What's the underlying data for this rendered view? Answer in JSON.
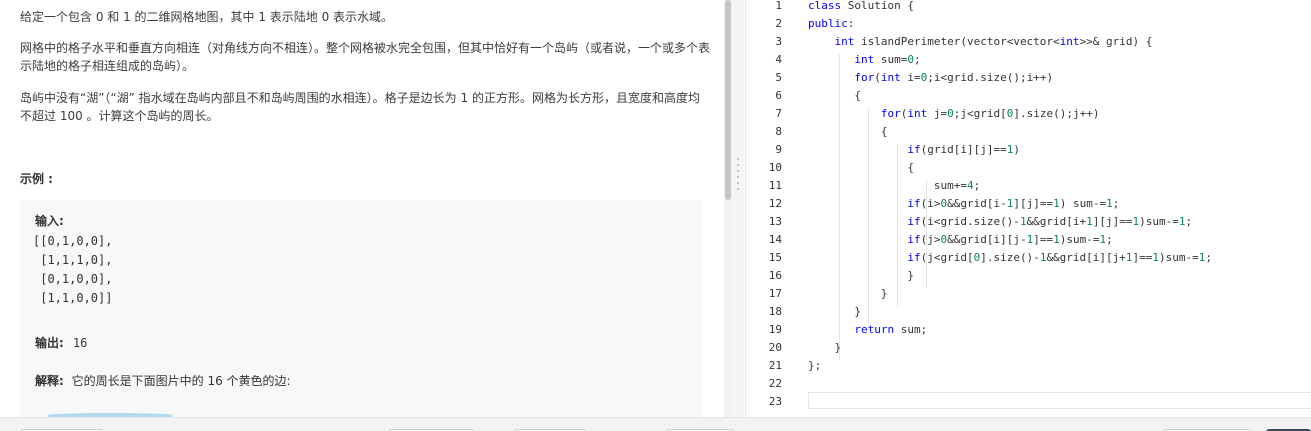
{
  "problem": {
    "paragraphs": [
      "给定一个包含 0 和 1 的二维网格地图，其中 1 表示陆地 0 表示水域。",
      "网格中的格子水平和垂直方向相连（对角线方向不相连）。整个网格被水完全包围，但其中恰好有一个岛屿（或者说，一个或多个表示陆地的格子相连组成的岛屿）。",
      "岛屿中没有“湖”（“湖” 指水域在岛屿内部且不和岛屿周围的水相连）。格子是边长为 1 的正方形。网格为长方形，且宽度和高度均不超过 100 。计算这个岛屿的周长。"
    ],
    "example_heading": "示例 :",
    "example": {
      "input_label": "输入:",
      "input_lines": [
        "[[0,1,0,0],",
        " [1,1,1,0],",
        " [0,1,0,0],",
        " [1,1,0,0]]"
      ],
      "output_label": "输出:",
      "output_value": "16",
      "explain_label": "解释:",
      "explain_text": "它的周长是下面图片中的 16 个黄色的边:"
    }
  },
  "editor": {
    "lines": [
      {
        "num": "1",
        "tokens": [
          {
            "t": "k",
            "s": "class"
          },
          {
            "t": "p",
            "s": " Solution {"
          }
        ]
      },
      {
        "num": "2",
        "tokens": [
          {
            "t": "k",
            "s": "public"
          },
          {
            "t": "p",
            "s": ":"
          }
        ]
      },
      {
        "num": "3",
        "tokens": [
          {
            "t": "p",
            "s": "    "
          },
          {
            "t": "k",
            "s": "int"
          },
          {
            "t": "p",
            "s": " islandPerimeter(vector<vector<"
          },
          {
            "t": "k",
            "s": "int"
          },
          {
            "t": "p",
            "s": ">>& grid) {"
          }
        ]
      },
      {
        "num": "4",
        "tokens": [
          {
            "t": "p",
            "s": "       "
          },
          {
            "t": "k",
            "s": "int"
          },
          {
            "t": "p",
            "s": " sum="
          },
          {
            "t": "n",
            "s": "0"
          },
          {
            "t": "p",
            "s": ";"
          }
        ]
      },
      {
        "num": "5",
        "tokens": [
          {
            "t": "p",
            "s": "       "
          },
          {
            "t": "k",
            "s": "for"
          },
          {
            "t": "p",
            "s": "("
          },
          {
            "t": "k",
            "s": "int"
          },
          {
            "t": "p",
            "s": " i="
          },
          {
            "t": "n",
            "s": "0"
          },
          {
            "t": "p",
            "s": ";i<grid.size();i++)"
          }
        ]
      },
      {
        "num": "6",
        "tokens": [
          {
            "t": "p",
            "s": "       {"
          }
        ]
      },
      {
        "num": "7",
        "tokens": [
          {
            "t": "p",
            "s": "           "
          },
          {
            "t": "k",
            "s": "for"
          },
          {
            "t": "p",
            "s": "("
          },
          {
            "t": "k",
            "s": "int"
          },
          {
            "t": "p",
            "s": " j="
          },
          {
            "t": "n",
            "s": "0"
          },
          {
            "t": "p",
            "s": ";j<grid["
          },
          {
            "t": "n",
            "s": "0"
          },
          {
            "t": "p",
            "s": "].size();j++)"
          }
        ]
      },
      {
        "num": "8",
        "tokens": [
          {
            "t": "p",
            "s": "           {"
          }
        ]
      },
      {
        "num": "9",
        "tokens": [
          {
            "t": "p",
            "s": "               "
          },
          {
            "t": "k",
            "s": "if"
          },
          {
            "t": "p",
            "s": "(grid[i][j]=="
          },
          {
            "t": "n",
            "s": "1"
          },
          {
            "t": "p",
            "s": ")"
          }
        ]
      },
      {
        "num": "10",
        "tokens": [
          {
            "t": "p",
            "s": "               {"
          }
        ]
      },
      {
        "num": "11",
        "tokens": [
          {
            "t": "p",
            "s": "                   sum+="
          },
          {
            "t": "n",
            "s": "4"
          },
          {
            "t": "p",
            "s": ";"
          }
        ]
      },
      {
        "num": "12",
        "tokens": [
          {
            "t": "p",
            "s": "               "
          },
          {
            "t": "k",
            "s": "if"
          },
          {
            "t": "p",
            "s": "(i>"
          },
          {
            "t": "n",
            "s": "0"
          },
          {
            "t": "p",
            "s": "&&grid[i-"
          },
          {
            "t": "n",
            "s": "1"
          },
          {
            "t": "p",
            "s": "][j]=="
          },
          {
            "t": "n",
            "s": "1"
          },
          {
            "t": "p",
            "s": ") sum-="
          },
          {
            "t": "n",
            "s": "1"
          },
          {
            "t": "p",
            "s": ";"
          }
        ]
      },
      {
        "num": "13",
        "tokens": [
          {
            "t": "p",
            "s": "               "
          },
          {
            "t": "k",
            "s": "if"
          },
          {
            "t": "p",
            "s": "(i<grid.size()-"
          },
          {
            "t": "n",
            "s": "1"
          },
          {
            "t": "p",
            "s": "&&grid[i+"
          },
          {
            "t": "n",
            "s": "1"
          },
          {
            "t": "p",
            "s": "][j]=="
          },
          {
            "t": "n",
            "s": "1"
          },
          {
            "t": "p",
            "s": ")sum-="
          },
          {
            "t": "n",
            "s": "1"
          },
          {
            "t": "p",
            "s": ";"
          }
        ]
      },
      {
        "num": "14",
        "tokens": [
          {
            "t": "p",
            "s": "               "
          },
          {
            "t": "k",
            "s": "if"
          },
          {
            "t": "p",
            "s": "(j>"
          },
          {
            "t": "n",
            "s": "0"
          },
          {
            "t": "p",
            "s": "&&grid[i][j-"
          },
          {
            "t": "n",
            "s": "1"
          },
          {
            "t": "p",
            "s": "]=="
          },
          {
            "t": "n",
            "s": "1"
          },
          {
            "t": "p",
            "s": ")sum-="
          },
          {
            "t": "n",
            "s": "1"
          },
          {
            "t": "p",
            "s": ";"
          }
        ]
      },
      {
        "num": "15",
        "tokens": [
          {
            "t": "p",
            "s": "               "
          },
          {
            "t": "k",
            "s": "if"
          },
          {
            "t": "p",
            "s": "(j<grid["
          },
          {
            "t": "n",
            "s": "0"
          },
          {
            "t": "p",
            "s": "].size()-"
          },
          {
            "t": "n",
            "s": "1"
          },
          {
            "t": "p",
            "s": "&&grid[i][j+"
          },
          {
            "t": "n",
            "s": "1"
          },
          {
            "t": "p",
            "s": "]=="
          },
          {
            "t": "n",
            "s": "1"
          },
          {
            "t": "p",
            "s": ")sum-="
          },
          {
            "t": "n",
            "s": "1"
          },
          {
            "t": "p",
            "s": ";"
          }
        ]
      },
      {
        "num": "16",
        "tokens": [
          {
            "t": "p",
            "s": "               }"
          }
        ]
      },
      {
        "num": "17",
        "tokens": [
          {
            "t": "p",
            "s": "           }"
          }
        ]
      },
      {
        "num": "18",
        "tokens": [
          {
            "t": "p",
            "s": "       }"
          }
        ]
      },
      {
        "num": "19",
        "tokens": [
          {
            "t": "p",
            "s": "       "
          },
          {
            "t": "k",
            "s": "return"
          },
          {
            "t": "p",
            "s": " sum;"
          }
        ]
      },
      {
        "num": "20",
        "tokens": [
          {
            "t": "p",
            "s": "    }"
          }
        ]
      },
      {
        "num": "21",
        "tokens": [
          {
            "t": "p",
            "s": "};"
          }
        ]
      },
      {
        "num": "22",
        "tokens": []
      },
      {
        "num": "23",
        "tokens": []
      }
    ]
  },
  "colors": {
    "keyword": "#0000ff",
    "number": "#098658",
    "text": "#333333",
    "example_bg": "#f7f8fa"
  }
}
